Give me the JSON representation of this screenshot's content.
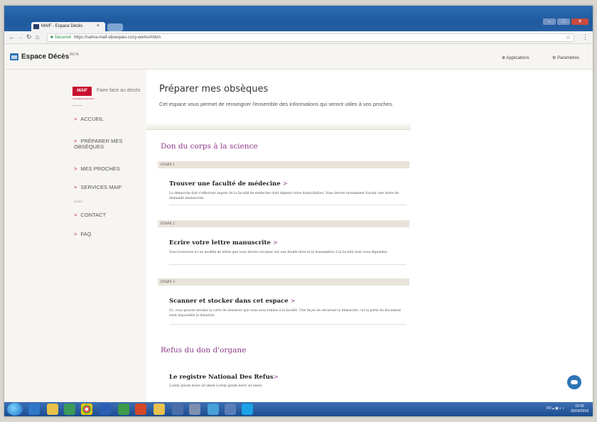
{
  "browser": {
    "tab_title": "MAIF - Espace Décès",
    "tab_close": "×",
    "secure_label": "Sécurisé",
    "url": "https://sahra-maif-obseques.cozy.works/#/don"
  },
  "app": {
    "title": "Espace Décès",
    "badge": "BETA",
    "links": [
      "Applications",
      "Paramètres"
    ]
  },
  "sidebar": {
    "brand": "MAIF",
    "brand_sub": "ASSUREUR MILITANT",
    "tagline": "Faire face au décès",
    "items": [
      {
        "label": "ACCUEIL"
      },
      {
        "label": "PRÉPARER MES",
        "label2": "OBSÈQUES"
      },
      {
        "label": "MES PROCHES"
      },
      {
        "label": "SERVICES MAIF"
      }
    ],
    "section_label": "AIDES",
    "help_items": [
      {
        "label": "CONTACT"
      },
      {
        "label": "FAQ"
      }
    ]
  },
  "main": {
    "title": "Préparer mes obsèques",
    "intro": "Cet espace vous permet de renseigner l'ensemble des informations qui seront utiles à vos proches.",
    "section1": {
      "title": "Don du corps à la science",
      "steps": [
        {
          "label": "ETAPE 1",
          "title": "Trouver une faculté de médecine",
          "arrow": ">",
          "desc": "La démarche doit s'effectuer auprès de la faculté de médecine dont dépend votre domiciliation. Vous devrez notamment fournir une lettre de demande manuscrite."
        },
        {
          "label": "ETAPE 2",
          "title": "Ecrire votre lettre manuscrite",
          "arrow": ">",
          "desc": "Vous trouverez ici un modèle de lettre que vous devrez recopier sur une feuille libre et la transmettre à la faculté dont vous dépendez."
        },
        {
          "label": "ETAPE 3",
          "title": "Scanner et stocker dans cet espace",
          "arrow": ">",
          "desc": "Ici, vous pouvez stocker la carte de donateur que vous aura remise à la faculté. Une façon de sécuriser la démarche, car la perte du document rend impossible la donation."
        }
      ]
    },
    "section2": {
      "title": "Refus du don d'organe",
      "item_title": "Le registre National Des Refus",
      "item_arrow": ">",
      "item_desc": "Lorem Ipsum dolor sit amen Lorem ipsum dolor sit amen"
    }
  },
  "taskbar": {
    "lang": "FR",
    "time": "15:42",
    "date": "25/04/2018"
  },
  "colors": {
    "accent_purple": "#8e3a8c",
    "maif_red": "#c8102e",
    "app_blue": "#2e75b6"
  }
}
